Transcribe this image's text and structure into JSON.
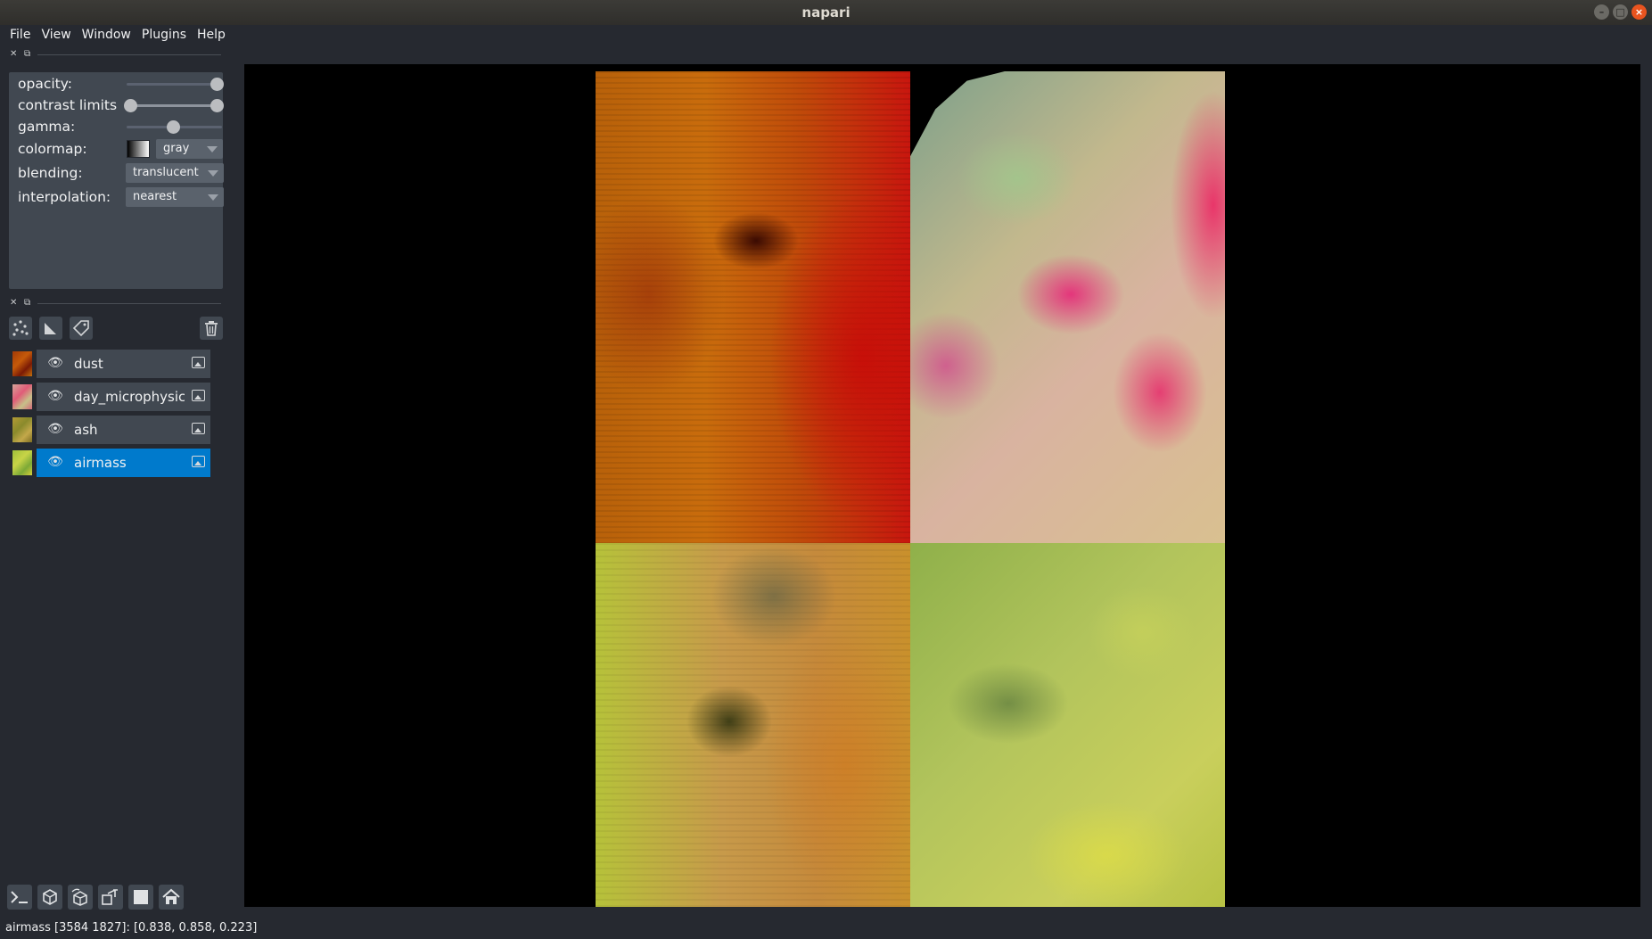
{
  "window": {
    "title": "napari"
  },
  "menu": [
    "File",
    "View",
    "Window",
    "Plugins",
    "Help"
  ],
  "controls": {
    "opacity_label": "opacity:",
    "opacity_value": 1.0,
    "contrast_label": "contrast limits",
    "contrast_range": [
      0.0,
      1.0
    ],
    "gamma_label": "gamma:",
    "gamma_value": 0.5,
    "colormap_label": "colormap:",
    "colormap_value": "gray",
    "blending_label": "blending:",
    "blending_value": "translucent",
    "interpolation_label": "interpolation:",
    "interpolation_value": "nearest"
  },
  "layer_toolbar": {
    "icons": [
      "new-points-icon",
      "new-shapes-icon",
      "new-labels-icon",
      "delete-layer-icon"
    ]
  },
  "layers": [
    {
      "name": "dust",
      "visible": true,
      "selected": false
    },
    {
      "name": "day_microphysics",
      "visible": true,
      "selected": false
    },
    {
      "name": "ash",
      "visible": true,
      "selected": false
    },
    {
      "name": "airmass",
      "visible": true,
      "selected": true
    }
  ],
  "bottom_buttons": [
    "console-icon",
    "ndisplay-icon",
    "roll-icon",
    "transpose-icon",
    "grid-icon",
    "home-icon"
  ],
  "colors": {
    "accent": "#007acc",
    "background": "#262930",
    "panel": "#414851"
  },
  "status": "airmass [3584 1827]: [0.838, 0.858, 0.223]"
}
